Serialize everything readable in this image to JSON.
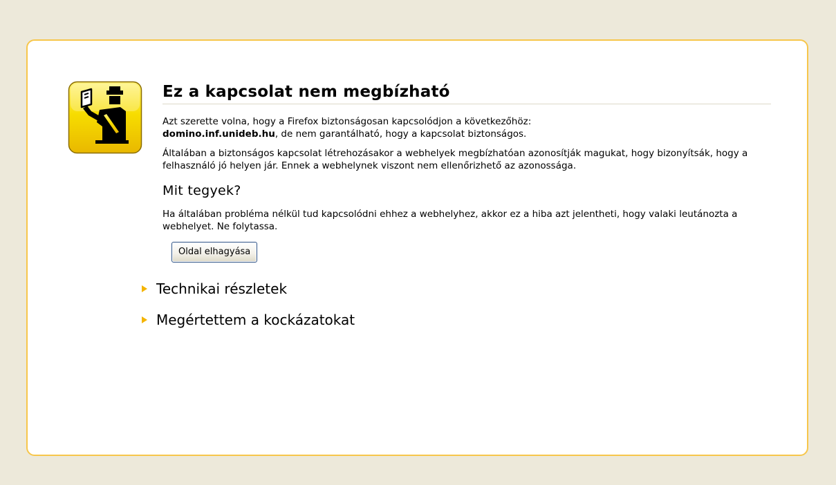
{
  "page": {
    "heading": "Ez a kapcsolat nem megbízható",
    "intro_text_1": "Azt szerette volna, hogy a Firefox biztonságosan kapcsolódjon a következőhöz:",
    "intro_host": "domino.inf.unideb.hu",
    "intro_text_2": ", de nem garantálható, hogy a kapcsolat biztonságos.",
    "explanation": "Általában a biztonságos kapcsolat létrehozásakor a webhelyek megbízhatóan azonosítják magukat, hogy bizonyítsák, hogy a felhasználó jó helyen jár. Ennek a webhelynek viszont nem ellenőrizhető az azonossága.",
    "what_to_do_heading": "Mit tegyek?",
    "what_to_do_text": "Ha általában probléma nélkül tud kapcsolódni ehhez a webhelyhez, akkor ez a hiba azt jelentheti, hogy valaki leutánozta a webhelyet. Ne folytassa.",
    "leave_button_label": "Oldal elhagyása",
    "technical_details_label": "Technikai részletek",
    "understand_risks_label": "Megértettem a kockázatokat"
  },
  "colors": {
    "page_background": "#ede9da",
    "box_border": "#f7c64a",
    "expander_triangle": "#f4b400",
    "icon_yellow": "#f5d400"
  },
  "icons": {
    "main_icon": "security-officer-icon",
    "expander_icon": "triangle-right-icon"
  }
}
